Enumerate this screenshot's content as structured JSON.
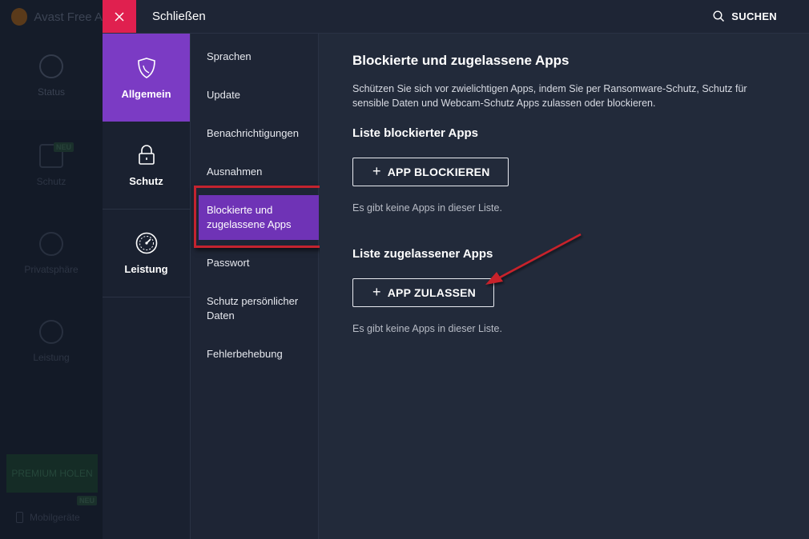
{
  "background_app": {
    "title": "Avast Free A",
    "nav": [
      {
        "label": "Status",
        "icon": "check-circle-icon"
      },
      {
        "label": "Schutz",
        "icon": "lock-icon",
        "badge": "NEU"
      },
      {
        "label": "Privatsphäre",
        "icon": "fingerprint-icon"
      },
      {
        "label": "Leistung",
        "icon": "speedometer-icon"
      }
    ],
    "premium_label": "PREMIUM HOLEN",
    "mobile_label": "Mobilgeräte",
    "mobile_badge": "NEU"
  },
  "topbar": {
    "close_label": "Schließen",
    "search_label": "SUCHEN"
  },
  "categories": [
    {
      "label": "Allgemein",
      "icon": "shield-icon",
      "active": true
    },
    {
      "label": "Schutz",
      "icon": "lock-icon",
      "active": false
    },
    {
      "label": "Leistung",
      "icon": "speedometer-icon",
      "active": false
    }
  ],
  "subnav": {
    "items": [
      "Sprachen",
      "Update",
      "Benachrichtigungen",
      "Ausnahmen",
      "Blockierte und zugelassene Apps",
      "Passwort",
      "Schutz persönlicher Daten",
      "Fehlerbehebung"
    ],
    "active_index": 4
  },
  "content": {
    "title": "Blockierte und zugelassene Apps",
    "description": "Schützen Sie sich vor zwielichtigen Apps, indem Sie per Ransomware-Schutz, Schutz für sensible Daten und Webcam-Schutz Apps zulassen oder blockieren.",
    "blocked": {
      "heading": "Liste blockierter Apps",
      "button": "APP BLOCKIEREN",
      "empty": "Es gibt keine Apps in dieser Liste."
    },
    "allowed": {
      "heading": "Liste zugelassener Apps",
      "button": "APP ZULASSEN",
      "empty": "Es gibt keine Apps in dieser Liste."
    }
  },
  "colors": {
    "accent_purple": "#7b3bc4",
    "close_red": "#e0204f",
    "highlight_red": "#c4232f",
    "background": "#222a3a"
  }
}
